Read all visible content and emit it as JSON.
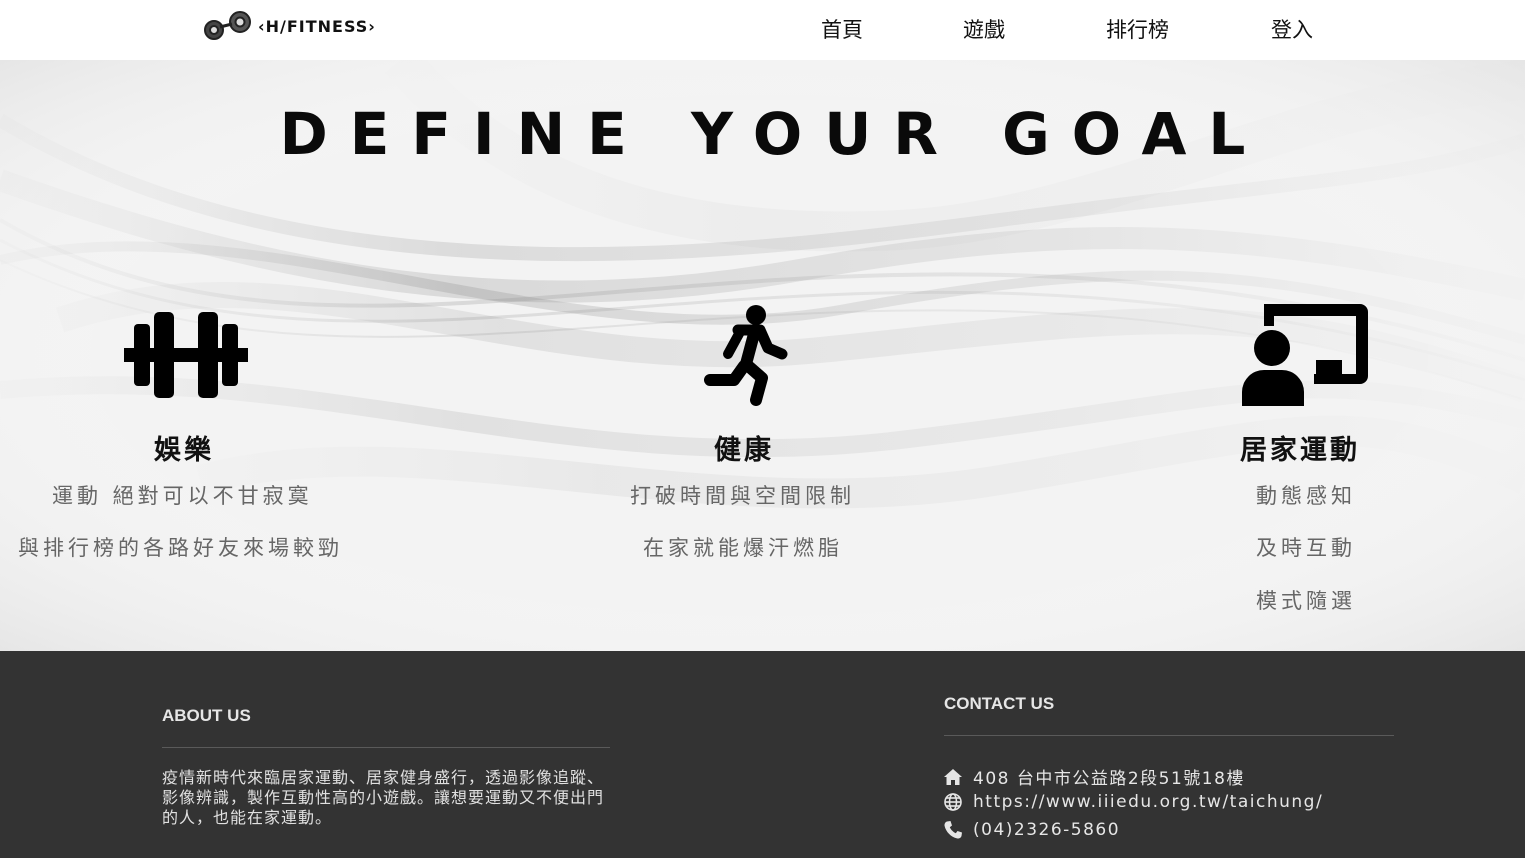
{
  "nav": {
    "logo_text": "‹H/FITNESS›",
    "items": [
      {
        "label": "首頁"
      },
      {
        "label": "遊戲"
      },
      {
        "label": "排行榜"
      },
      {
        "label": "登入"
      }
    ]
  },
  "hero": {
    "title": "DEFINE YOUR GOAL",
    "features": [
      {
        "icon": "dumbbell-icon",
        "title": "娛樂",
        "lines": [
          "運動 絕對可以不甘寂寞",
          "與排行榜的各路好友來場較勁"
        ]
      },
      {
        "icon": "running-person-icon",
        "title": "健康",
        "lines": [
          "打破時間與空間限制",
          "在家就能爆汗燃脂"
        ]
      },
      {
        "icon": "chalkboard-user-icon",
        "title": "居家運動",
        "lines": [
          "動態感知",
          "及時互動",
          "模式隨選"
        ]
      }
    ]
  },
  "footer": {
    "about": {
      "heading": "ABOUT US",
      "text": "疫情新時代來臨居家運動、居家健身盛行，透過影像追蹤、影像辨識，製作互動性高的小遊戲。讓想要運動又不便出門的人，也能在家運動。"
    },
    "contact": {
      "heading": "CONTACT US",
      "address": "408 台中市公益路2段51號18樓",
      "website": "https://www.iiiedu.org.tw/taichung/",
      "phone": "(04)2326-5860"
    }
  },
  "colors": {
    "footer_bg": "#333333",
    "text_dark": "#111111",
    "text_muted": "#666666"
  }
}
